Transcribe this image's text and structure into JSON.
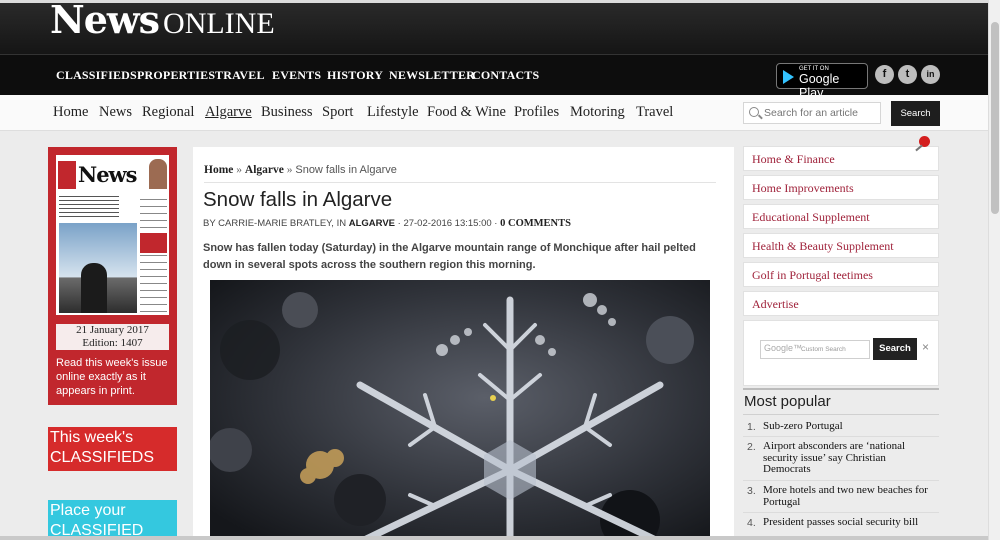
{
  "brand": {
    "logo_main": "News",
    "logo_sub": "ONLINE"
  },
  "primary_nav": [
    "CLASSIFIEDS",
    "PROPERTIES",
    "TRAVEL",
    "EVENTS",
    "HISTORY",
    "NEWSLETTER",
    "CONTACTS"
  ],
  "google_play": {
    "small": "GET IT ON",
    "big": "Google Play"
  },
  "social": {
    "facebook": "f",
    "twitter": "t",
    "linkedin": "in"
  },
  "secondary_nav": {
    "items": [
      "Home",
      "News",
      "Regional",
      "Algarve",
      "Business",
      "Sport",
      "Lifestyle",
      "Food & Wine",
      "Profiles",
      "Motoring",
      "Travel"
    ],
    "active": "Algarve"
  },
  "site_search": {
    "placeholder": "Search for an article",
    "button": "Search"
  },
  "paper": {
    "cover_title": "News",
    "date": "21 January 2017",
    "edition": "Edition: 1407",
    "promo": "Read this week's issue online exactly as it appears in print."
  },
  "promos": {
    "classifieds": "This week's CLASSIFIEDS",
    "place_ad": "Place your CLASSIFIED"
  },
  "article": {
    "breadcrumb": {
      "home": "Home",
      "sep": "»",
      "section": "Algarve",
      "current": "Snow falls in Algarve"
    },
    "title": "Snow falls in Algarve",
    "byline_prefix": "BY CARRIE-MARIE BRATLEY, IN",
    "byline_section": "ALGARVE",
    "byline_date": "· 27-02-2016 13:15:00 ·",
    "comments": "0 COMMENTS",
    "standfirst": "Snow has fallen today (Saturday) in the Algarve mountain range of Monchique after hail pelted down in several spots across the southern region this morning."
  },
  "sidebar_links": [
    "Home & Finance",
    "Home Improvements",
    "Educational Supplement",
    "Health & Beauty Supplement",
    "Golf in Portugal teetimes",
    "Advertise"
  ],
  "custom_search": {
    "logo": "Google™",
    "placeholder": "Custom Search",
    "button": "Search",
    "close": "×"
  },
  "most_popular": {
    "title": "Most popular",
    "items": [
      {
        "num": "1.",
        "text": "Sub-zero Portugal"
      },
      {
        "num": "2.",
        "text": "Airport absconders are ‘national security issue’ say Christian Democrats"
      },
      {
        "num": "3.",
        "text": "More hotels and two new beaches for Portugal"
      },
      {
        "num": "4.",
        "text": "President passes social security bill"
      }
    ]
  },
  "colors": {
    "accent_red": "#c1272d",
    "link_crimson": "#a0233b",
    "cyan_promo": "#34c8df",
    "header_dark": "#151515"
  }
}
